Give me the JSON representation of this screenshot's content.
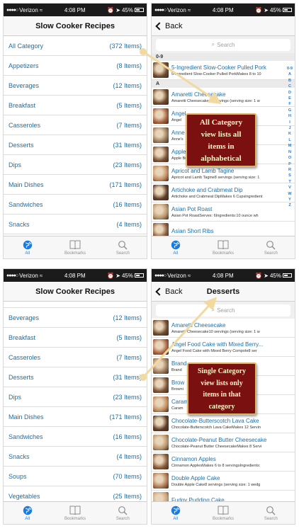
{
  "status": {
    "carrier": "Verizon",
    "time": "4:08 PM",
    "battery": "45%"
  },
  "tabs": [
    {
      "label": "All"
    },
    {
      "label": "Bookmarks"
    },
    {
      "label": "Search"
    }
  ],
  "screen1": {
    "title": "Slow Cooker Recipes",
    "categories": [
      {
        "name": "All Category",
        "count": "(372 Items)"
      },
      {
        "name": "Appetizers",
        "count": "(8 Items)"
      },
      {
        "name": "Beverages",
        "count": "(12 Items)"
      },
      {
        "name": "Breakfast",
        "count": "(5 Items)"
      },
      {
        "name": "Casseroles",
        "count": "(7 Items)"
      },
      {
        "name": "Desserts",
        "count": "(31 Items)"
      },
      {
        "name": "Dips",
        "count": "(23 Items)"
      },
      {
        "name": "Main Dishes",
        "count": "(171 Items)"
      },
      {
        "name": "Sandwiches",
        "count": "(16 Items)"
      },
      {
        "name": "Snacks",
        "count": "(4 Items)"
      }
    ]
  },
  "screen2": {
    "back_label": "Back",
    "search_placeholder": "Search",
    "sections": {
      "s1": "0-9",
      "s2": "A"
    },
    "recipes_s1": [
      {
        "title": "5-Ingredient Slow-Cooker Pulled Pork",
        "sub": "5-Ingredient Slow-Cooker Pulled PorkMakes 8 to 10"
      }
    ],
    "recipes_s2": [
      {
        "title": "Amaretti Cheesecake",
        "sub": "Amaretti Cheesecake10 servings (serving size: 1 w"
      },
      {
        "title": "Angel",
        "sub": "Angel"
      },
      {
        "title": "Anne",
        "sub": "Anne's"
      },
      {
        "title": "Apple",
        "sub": "Apple Butter"
      },
      {
        "title": "Apricot and Lamb Tagine",
        "sub": "Apricot and Lamb Tagine8 servings (serving size: 1"
      },
      {
        "title": "Artichoke and Crabmeat Dip",
        "sub": "Artichoke and Crabmeat DipMakes 6 Cupsingredient"
      },
      {
        "title": "Asian Pot Roast",
        "sub": "Asian Pot RoastServes: 6Ingredients:10 ounce wh"
      },
      {
        "title": "Asian Short Ribs",
        "sub": ""
      }
    ],
    "index_letters": [
      "0-9",
      "A",
      "B",
      "C",
      "D",
      "E",
      "F",
      "G",
      "H",
      "I",
      "J",
      "K",
      "L",
      "M",
      "N",
      "O",
      "P",
      "R",
      "S",
      "T",
      "V",
      "W",
      "Y",
      "Z"
    ]
  },
  "screen3": {
    "title": "Slow Cooker Recipes",
    "categories": [
      {
        "name": "Beverages",
        "count": "(12 Items)"
      },
      {
        "name": "Breakfast",
        "count": "(5 Items)"
      },
      {
        "name": "Casseroles",
        "count": "(7 Items)"
      },
      {
        "name": "Desserts",
        "count": "(31 Items)"
      },
      {
        "name": "Dips",
        "count": "(23 Items)"
      },
      {
        "name": "Main Dishes",
        "count": "(171 Items)"
      },
      {
        "name": "Sandwiches",
        "count": "(16 Items)"
      },
      {
        "name": "Snacks",
        "count": "(4 Items)"
      },
      {
        "name": "Soups",
        "count": "(70 Items)"
      },
      {
        "name": "Vegetables",
        "count": "(25 Items)"
      }
    ]
  },
  "screen4": {
    "back_label": "Back",
    "title": "Desserts",
    "search_placeholder": "Search",
    "recipes": [
      {
        "title": "Amaretti Cheesecake",
        "sub": "Amaretti Cheesecake10 servings (serving size: 1 w"
      },
      {
        "title": "Angel Food Cake with Mixed Berry...",
        "sub": "Angel Food Cake with Mixed Berry Compote8 ser"
      },
      {
        "title": "Brand",
        "sub": "Brand"
      },
      {
        "title": "Brow",
        "sub": "Browni"
      },
      {
        "title": "Caram",
        "sub": "Caram"
      },
      {
        "title": "Chocolate-Butterscotch Lava Cake",
        "sub": "Chocolate-Butterscotch Lava CakeMakes 12 Servin"
      },
      {
        "title": "Chocolate-Peanut Butter Cheesecake",
        "sub": "Chocolate-Peanut Butter CheesecakeMakes 8 Servi"
      },
      {
        "title": "Cinnamon Apples",
        "sub": "Cinnamon ApplesMakes 6 to 8 servingsIngredients:"
      },
      {
        "title": "Double Apple Cake",
        "sub": "Double Apple Cake8 servings (serving size: 1 wedg"
      },
      {
        "title": "Fudgy Pudding Cake",
        "sub": ""
      }
    ]
  },
  "callouts": {
    "top": [
      "All Category",
      "view lists all",
      "items in",
      "alphabetical"
    ],
    "bottom": [
      "Single Category",
      "view lists only",
      "items in that",
      "category"
    ]
  },
  "colors": {
    "link": "#1e6fa6",
    "tab_active": "#1a7ce0",
    "callout_bg": "#7a1010",
    "callout_border": "#d9b56a",
    "arrow": "#f2d9a0"
  }
}
